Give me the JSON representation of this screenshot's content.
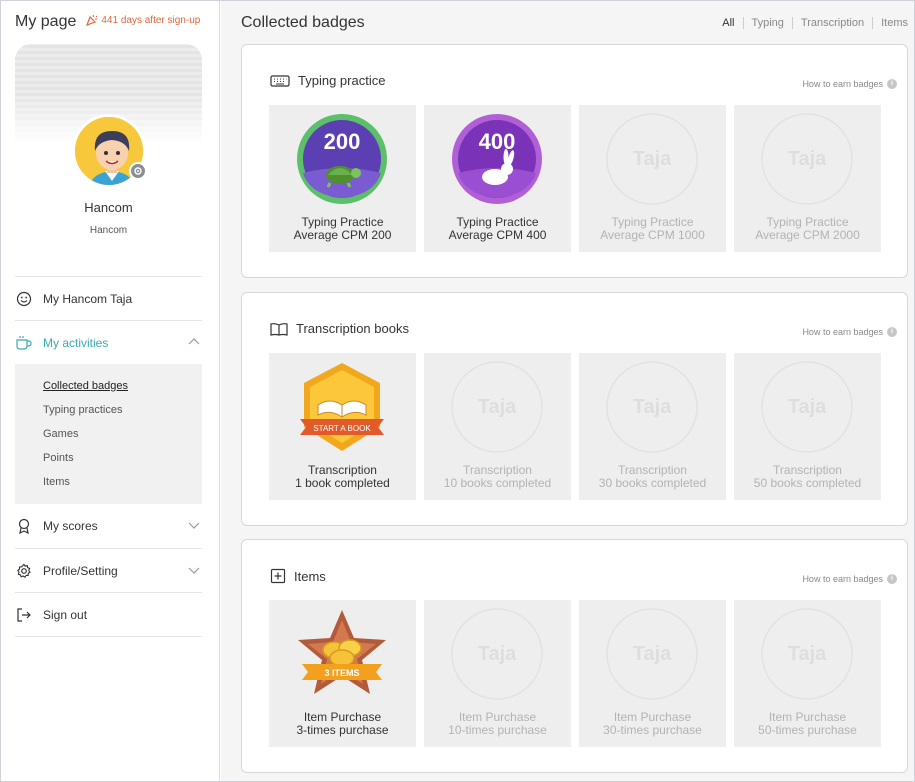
{
  "sidebar": {
    "title": "My page",
    "days": "441 days after sign-up",
    "profile_name": "Hancom",
    "profile_id": "Hancom",
    "nav": [
      {
        "label": "My Hancom Taja",
        "icon": "smile-icon"
      },
      {
        "label": "My activities",
        "icon": "cup-icon",
        "active": true
      },
      {
        "label": "My scores",
        "icon": "ribbon-icon"
      },
      {
        "label": "Profile/Setting",
        "icon": "gear-icon"
      },
      {
        "label": "Sign out",
        "icon": "signout-icon"
      }
    ],
    "subnav": [
      "Collected badges",
      "Typing practices",
      "Games",
      "Points",
      "Items"
    ]
  },
  "main": {
    "title": "Collected badges",
    "filters": [
      "All",
      "Typing",
      "Transcription",
      "Items"
    ],
    "how_to_earn": "How to earn badges",
    "sections": [
      {
        "title": "Typing practice",
        "badges": [
          {
            "line1": "Typing Practice",
            "line2": "Average CPM 200",
            "number": "200",
            "earned": true
          },
          {
            "line1": "Typing Practice",
            "line2": "Average CPM 400",
            "number": "400",
            "earned": true
          },
          {
            "line1": "Typing Practice",
            "line2": "Average CPM 1000",
            "earned": false
          },
          {
            "line1": "Typing Practice",
            "line2": "Average CPM 2000",
            "earned": false
          }
        ]
      },
      {
        "title": "Transcription books",
        "badges": [
          {
            "line1": "Transcription",
            "line2": "1 book completed",
            "ribbon": "START A BOOK",
            "earned": true
          },
          {
            "line1": "Transcription",
            "line2": "10 books completed",
            "earned": false
          },
          {
            "line1": "Transcription",
            "line2": "30 books completed",
            "earned": false
          },
          {
            "line1": "Transcription",
            "line2": "50 books completed",
            "earned": false
          }
        ]
      },
      {
        "title": "Items",
        "badges": [
          {
            "line1": "Item Purchase",
            "line2": "3-times purchase",
            "ribbon": "3 ITEMS",
            "earned": true
          },
          {
            "line1": "Item Purchase",
            "line2": "10-times purchase",
            "earned": false
          },
          {
            "line1": "Item Purchase",
            "line2": "30-times purchase",
            "earned": false
          },
          {
            "line1": "Item Purchase",
            "line2": "50-times purchase",
            "earned": false
          }
        ]
      }
    ],
    "locked_logo": "Taja"
  },
  "colors": {
    "accent": "#3ba9b4",
    "days": "#e0663a",
    "badge_purple": "#5b3fb3",
    "badge_violet": "#8a3fc9",
    "badge_green": "#5cbf6a"
  }
}
